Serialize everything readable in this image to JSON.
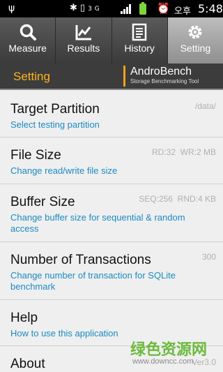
{
  "status_bar": {
    "ampm": "오후",
    "time": "5:48",
    "usb_icon": "usb-icon",
    "battery_color": "#7fd43a"
  },
  "tabs": [
    {
      "label": "Measure",
      "icon": "magnifier-icon",
      "active": false
    },
    {
      "label": "Results",
      "icon": "chart-icon",
      "active": false
    },
    {
      "label": "History",
      "icon": "document-icon",
      "active": false
    },
    {
      "label": "Setting",
      "icon": "gear-icon",
      "active": true
    }
  ],
  "title_bar": {
    "title": "Setting",
    "brand_andro": "Andro",
    "brand_bench": "Bench",
    "brand_tagline": "Storage Benchmarking Tool",
    "title_color": "#ffb41a"
  },
  "settings": [
    {
      "title": "Target Partition",
      "subtitle": "Select testing partition",
      "value": "/data/"
    },
    {
      "title": "File Size",
      "subtitle": "Change read/write file size",
      "value": "RD:32  WR:2 MB"
    },
    {
      "title": "Buffer Size",
      "subtitle": "Change buffer size for sequential & random access",
      "value": "SEQ:256  RND:4 KB"
    },
    {
      "title": "Number of Transactions",
      "subtitle": "Change number of transaction for SQLite benchmark",
      "value": "300"
    },
    {
      "title": "Help",
      "subtitle": "How to use this application",
      "value": ""
    },
    {
      "title": "About",
      "subtitle": "",
      "value": "Ver3.0"
    }
  ],
  "watermark": {
    "text": "绿色资源网",
    "url": "www.downcc.com"
  }
}
